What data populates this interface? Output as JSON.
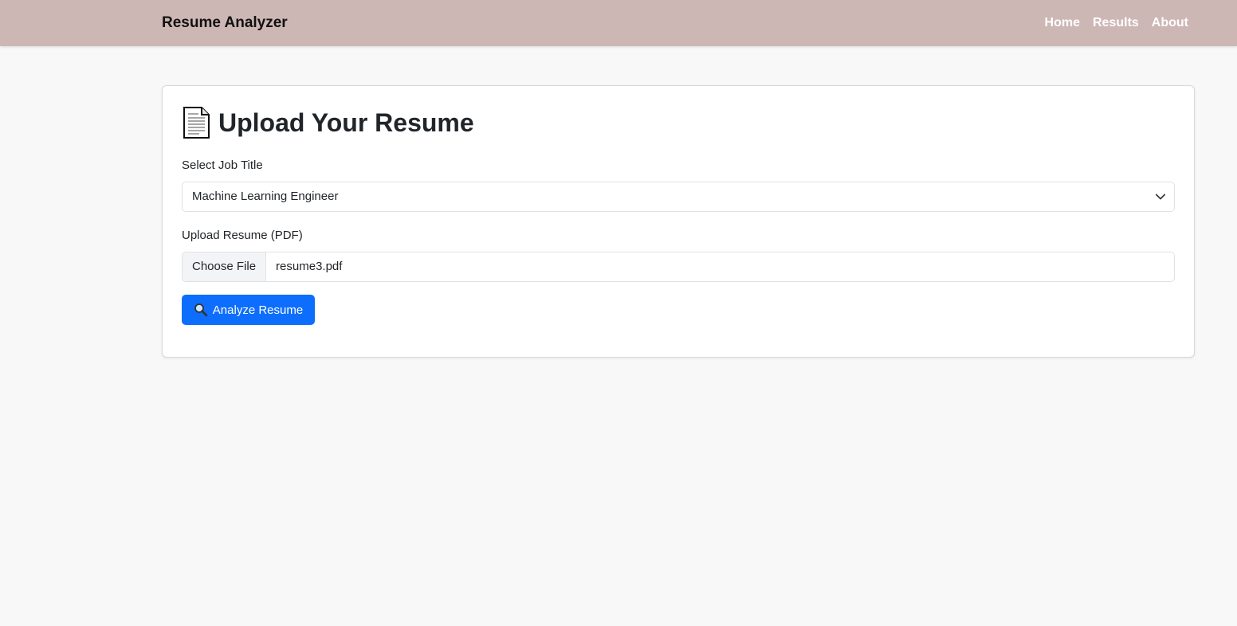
{
  "navbar": {
    "brand": "Resume Analyzer",
    "links": [
      "Home",
      "Results",
      "About"
    ]
  },
  "card": {
    "title": "Upload Your Resume",
    "title_icon": "document-icon",
    "job_label": "Select Job Title",
    "job_selected": "Machine Learning Engineer",
    "file_label": "Upload Resume (PDF)",
    "file_button": "Choose File",
    "file_name": "resume3.pdf",
    "analyze_button": "Analyze Resume",
    "analyze_icon": "magnifier-icon"
  },
  "colors": {
    "navbar_bg": "#cdb7b5",
    "primary": "#0d6efd",
    "page_bg": "#f8f8f8"
  }
}
